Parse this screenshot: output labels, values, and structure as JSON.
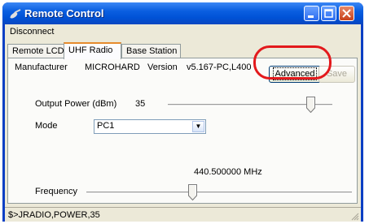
{
  "window": {
    "title": "Remote Control",
    "app_icon": "satellite-dish-icon",
    "controls": [
      "minimize-icon",
      "maximize-icon",
      "close-icon"
    ]
  },
  "menu": {
    "items": [
      "Disconnect"
    ]
  },
  "tabs": [
    {
      "label": "Remote LCD",
      "active": false
    },
    {
      "label": "UHF Radio",
      "active": true
    },
    {
      "label": "Base Station",
      "active": false
    }
  ],
  "uhf": {
    "manufacturer_label": "Manufacturer",
    "manufacturer_value": "MICROHARD",
    "version_label": "Version",
    "version_value": "v5.167-PC,L400",
    "advanced_button": "Advanced",
    "save_button": "Save",
    "output_power_label": "Output Power (dBm)",
    "output_power_value": "35",
    "output_power_slider_fraction": 0.87,
    "mode_label": "Mode",
    "mode_value": "PC1",
    "frequency_readout": "440.500000 MHz",
    "frequency_label": "Frequency",
    "frequency_slider_fraction": 0.4
  },
  "status": {
    "text": "$>JRADIO,POWER,35"
  },
  "colors": {
    "annotation": "#e3191c",
    "titlebar": "#0a5ee0",
    "face": "#ece9d8"
  }
}
